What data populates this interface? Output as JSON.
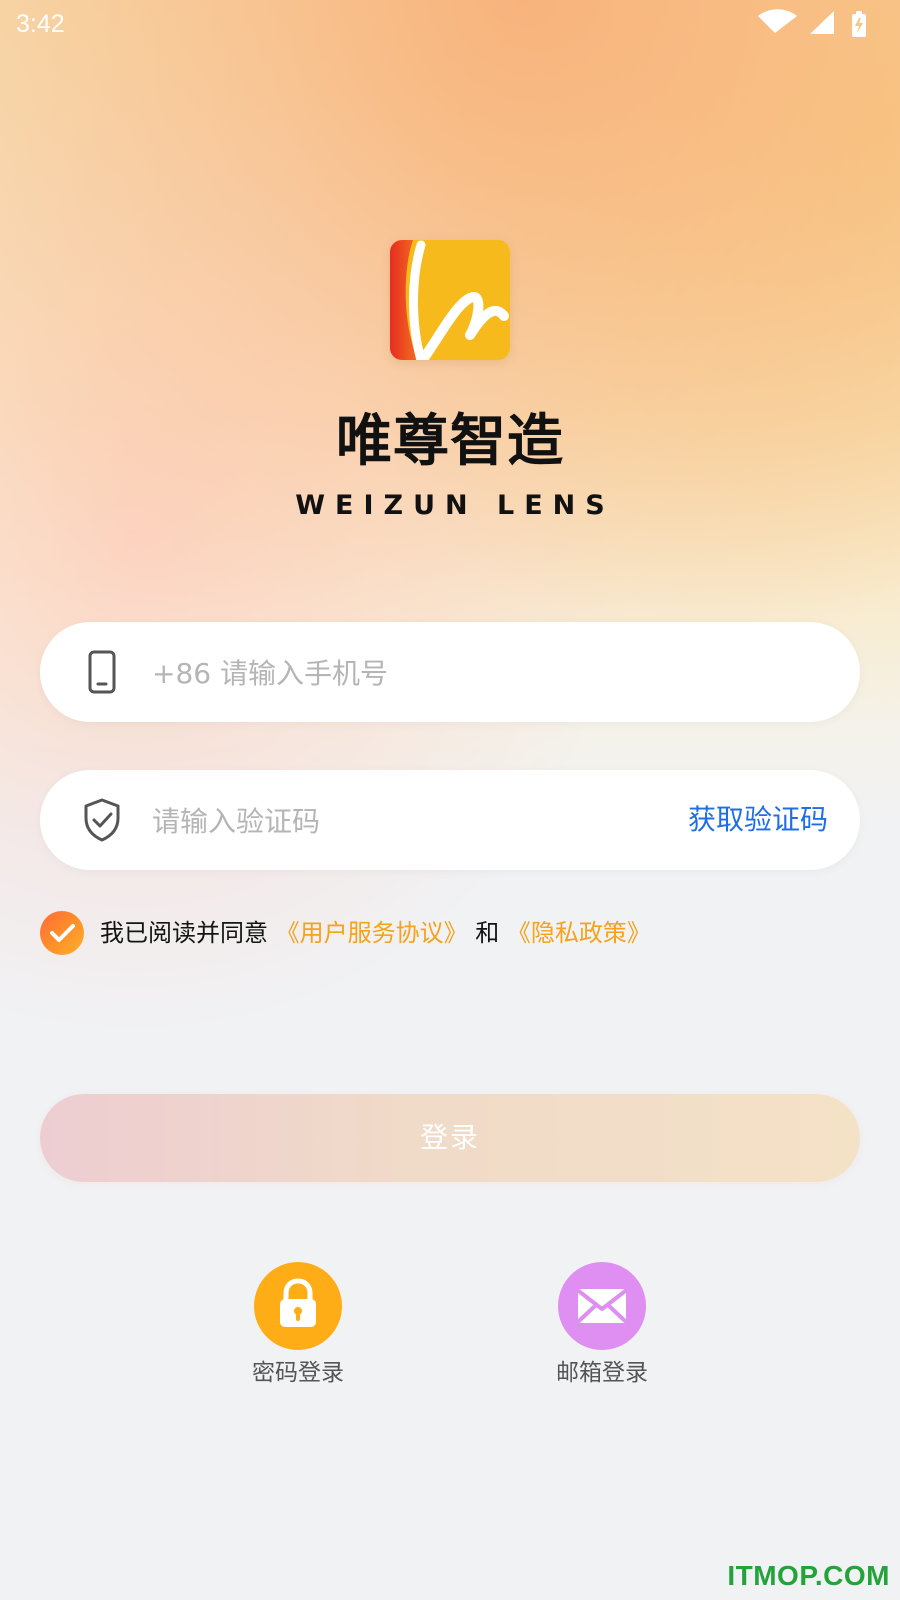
{
  "status_bar": {
    "time": "3:42",
    "icons": [
      "wifi-icon",
      "signal-icon",
      "battery-charging-icon"
    ]
  },
  "brand": {
    "logo": "weizun-lens-logo",
    "name": "唯尊智造",
    "subtitle": "WEIZUN LENS"
  },
  "login_form": {
    "phone_placeholder": "+86 请输入手机号",
    "code_placeholder": "请输入验证码",
    "get_code_label": "获取验证码",
    "agreement_prefix": "我已阅读并同意",
    "terms_link": "《用户服务协议》",
    "connector": "和",
    "privacy_link": "《隐私政策》",
    "login_button": "登录"
  },
  "alternate_login": {
    "password_label": "密码登录",
    "email_label": "邮箱登录"
  },
  "watermark": "ITMOP.COM",
  "colors": {
    "accent_orange": "#f5a21c",
    "link_blue": "#1f6ee6",
    "password_circle": "#ffad16",
    "email_circle": "#df8ef2",
    "watermark_green": "#25a33b"
  }
}
